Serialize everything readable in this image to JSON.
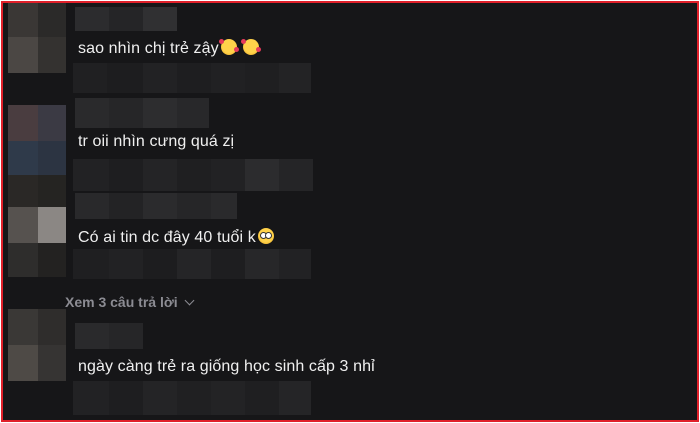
{
  "comments": [
    {
      "text": "sao nhìn chị trẻ zậy",
      "emojis": [
        "smiling-face-with-hearts",
        "smiling-face-with-hearts"
      ]
    },
    {
      "text": "tr oii nhìn cưng quá zị",
      "emojis": []
    },
    {
      "text": "Có ai tin dc đây 40 tuổi k",
      "emojis": [
        "flushed-face"
      ]
    },
    {
      "text": "ngày càng trẻ ra giống học sinh cấp 3 nhỉ",
      "emojis": []
    }
  ],
  "replies_link": {
    "label": "Xem 3 câu trả lời",
    "icon": "chevron-down-icon"
  },
  "colors": {
    "background": "#161618",
    "text": "#f0f0f0",
    "muted": "#8c8c93",
    "border": "#e0202a"
  }
}
